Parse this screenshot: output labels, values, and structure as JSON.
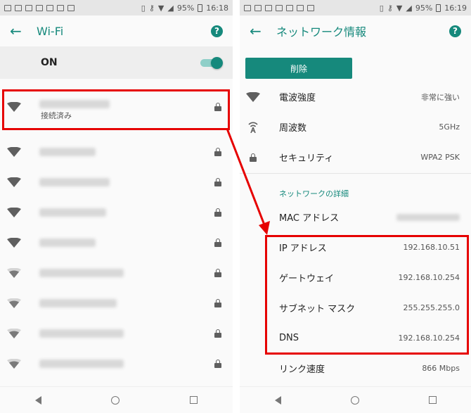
{
  "left": {
    "status": {
      "battery": "95%",
      "time": "16:18"
    },
    "title": "Wi-Fi",
    "toggle_label": "ON",
    "connected_status": "接続済み",
    "networks_count_visible": 9
  },
  "right": {
    "status": {
      "battery": "95%",
      "time": "16:19"
    },
    "title": "ネットワーク情報",
    "delete_label": "削除",
    "rows_top": [
      {
        "label": "電波強度",
        "value": "非常に強い",
        "icon": "wifi-signal-icon"
      },
      {
        "label": "周波数",
        "value": "5GHz",
        "icon": "frequency-icon"
      },
      {
        "label": "セキュリティ",
        "value": "WPA2 PSK",
        "icon": "lock-icon"
      }
    ],
    "section_title": "ネットワークの詳細",
    "mac_label": "MAC アドレス",
    "details": [
      {
        "label": "IP アドレス",
        "value": "192.168.10.51"
      },
      {
        "label": "ゲートウェイ",
        "value": "192.168.10.254"
      },
      {
        "label": "サブネット マスク",
        "value": "255.255.255.0"
      },
      {
        "label": "DNS",
        "value": "192.168.10.254"
      }
    ],
    "link_speed_label": "リンク速度",
    "link_speed_value": "866 Mbps"
  },
  "colors": {
    "accent": "#16897c",
    "highlight": "#e60000"
  }
}
